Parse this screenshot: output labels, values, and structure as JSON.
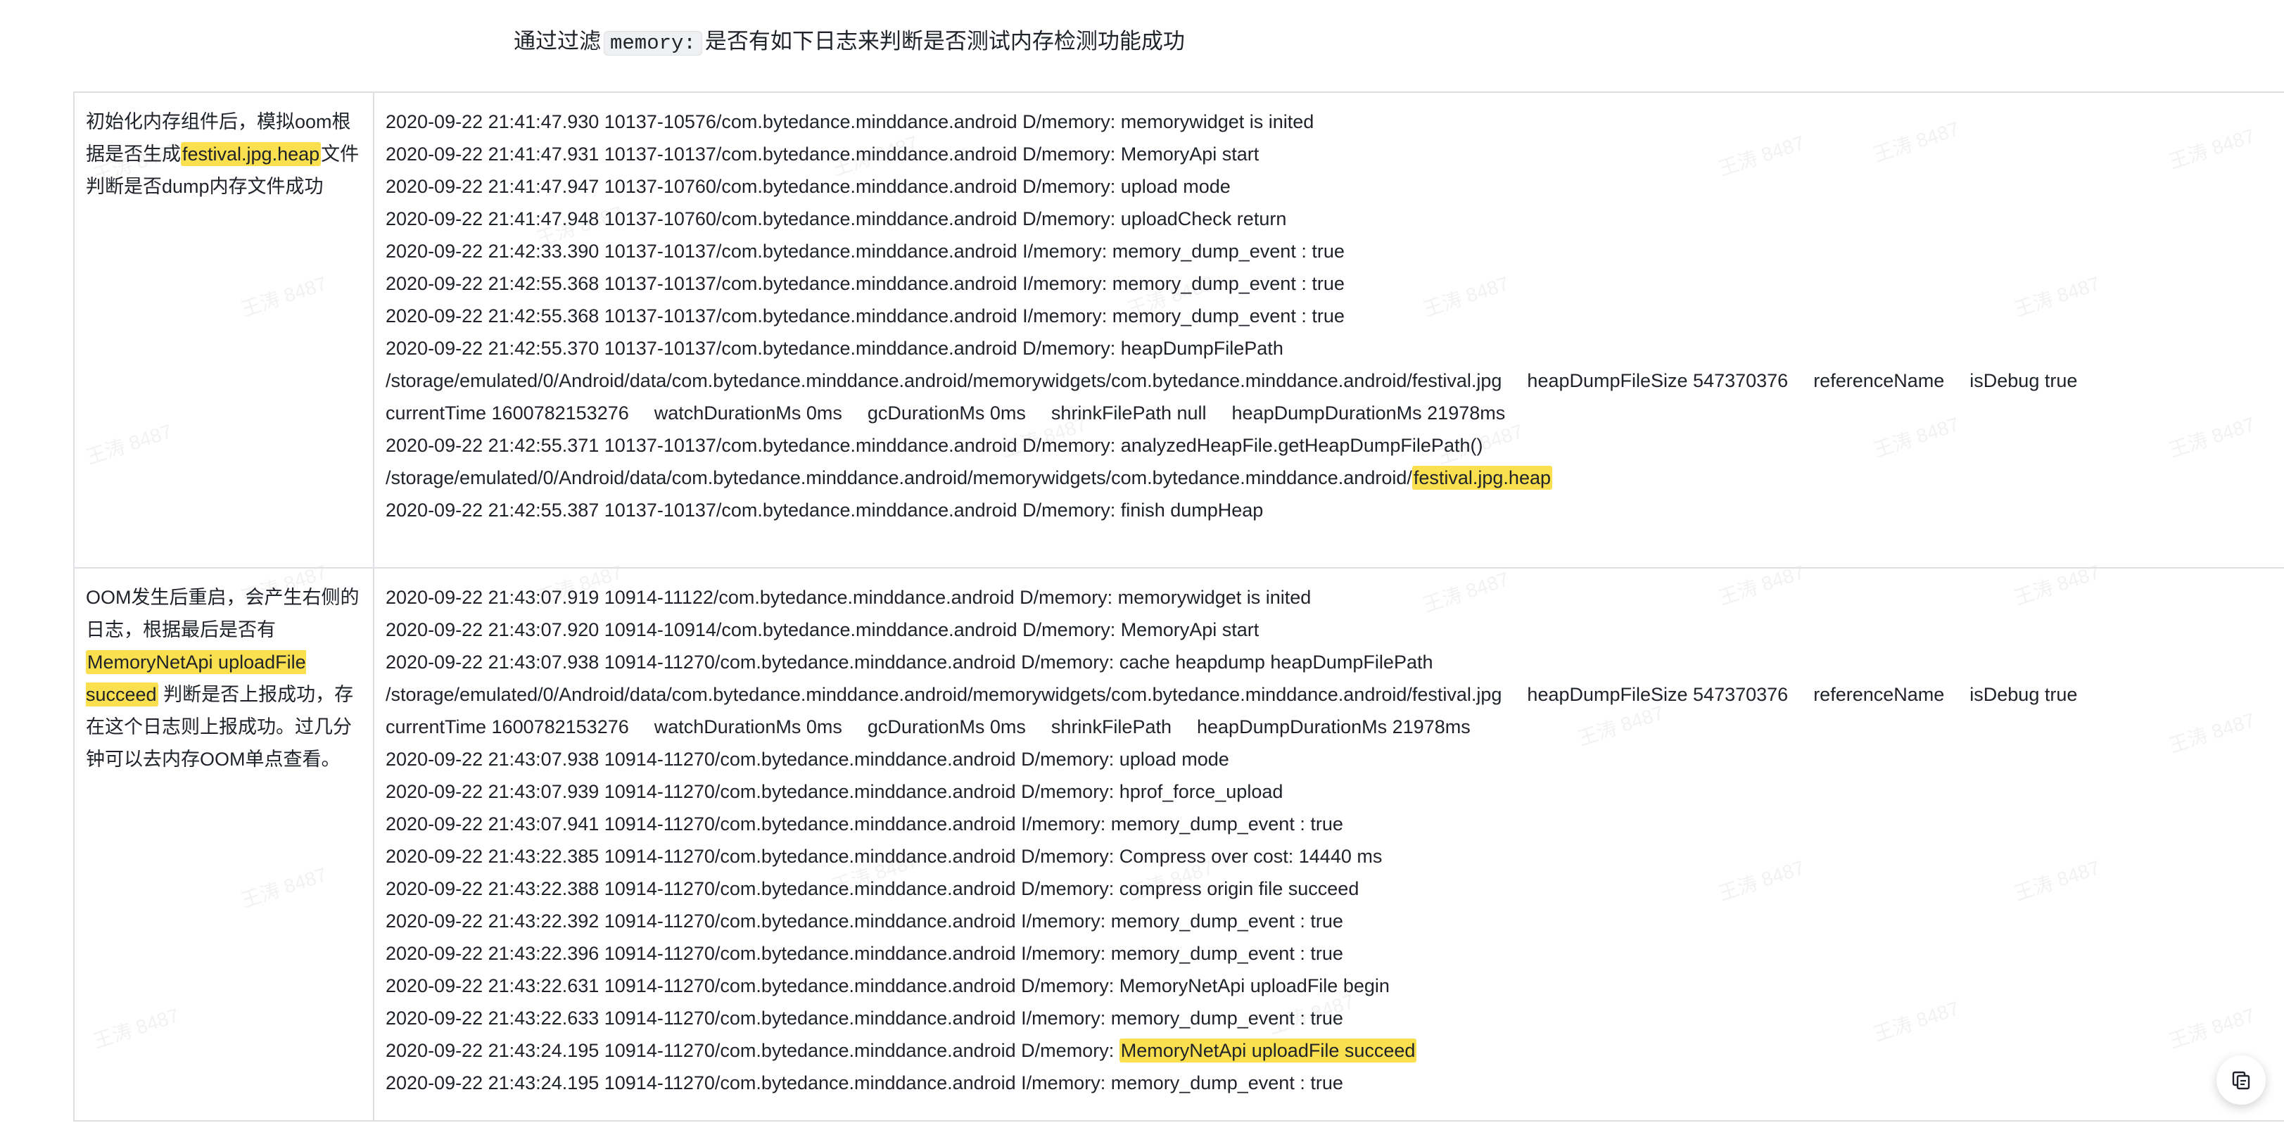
{
  "intro": {
    "prefix": "通过过滤",
    "code": "memory:",
    "suffix": "是否有如下日志来判断是否测试内存检测功能成功"
  },
  "watermark": "王涛 8487",
  "rows": [
    {
      "desc": {
        "part1": "初始化内存组件后，模拟oom根据是否生成",
        "highlight": "festival.jpg.heap",
        "part2": "文件判断是否dump内存文件成功"
      },
      "logs": [
        "2020-09-22 21:41:47.930 10137-10576/com.bytedance.minddance.android D/memory: memorywidget is inited",
        "2020-09-22 21:41:47.931 10137-10137/com.bytedance.minddance.android D/memory: MemoryApi start",
        "2020-09-22 21:41:47.947 10137-10760/com.bytedance.minddance.android D/memory: upload mode",
        "2020-09-22 21:41:47.948 10137-10760/com.bytedance.minddance.android D/memory: uploadCheck return",
        "2020-09-22 21:42:33.390 10137-10137/com.bytedance.minddance.android I/memory: memory_dump_event : true",
        "2020-09-22 21:42:55.368 10137-10137/com.bytedance.minddance.android I/memory: memory_dump_event : true",
        "2020-09-22 21:42:55.368 10137-10137/com.bytedance.minddance.android I/memory: memory_dump_event : true"
      ],
      "heap_dump": {
        "line1": "2020-09-22 21:42:55.370 10137-10137/com.bytedance.minddance.android D/memory:  heapDumpFilePath",
        "path": "/storage/emulated/0/Android/data/com.bytedance.minddance.android/memorywidgets/com.bytedance.minddance.android/festival.jpg",
        "size": "heapDumpFileSize 547370376",
        "ref": "referenceName",
        "debug": "isDebug true",
        "time": "currentTime 1600782153276",
        "watch": "watchDurationMs 0ms",
        "gc": "gcDurationMs 0ms",
        "shrink": "shrinkFilePath null",
        "duration": "heapDumpDurationMs 21978ms"
      },
      "analyzed": {
        "line1": "2020-09-22 21:42:55.371 10137-10137/com.bytedance.minddance.android D/memory: analyzedHeapFile.getHeapDumpFilePath()",
        "path_prefix": "/storage/emulated/0/Android/data/com.bytedance.minddance.android/memorywidgets/com.bytedance.minddance.android/",
        "path_highlight": "festival.jpg.heap"
      },
      "last": "2020-09-22 21:42:55.387 10137-10137/com.bytedance.minddance.android D/memory: finish dumpHeap"
    },
    {
      "desc": {
        "part1": "OOM发生后重启，会产生右侧的日志，根据最后是否有",
        "highlight": "MemoryNetApi uploadFile succeed",
        "part2": "判断是否上报成功，存在这个日志则上报成功。过几分钟可以去内存OOM单点查看。"
      },
      "logs_before": [
        "2020-09-22 21:43:07.919 10914-11122/com.bytedance.minddance.android D/memory: memorywidget is inited",
        "2020-09-22 21:43:07.920 10914-10914/com.bytedance.minddance.android D/memory: MemoryApi start"
      ],
      "heap_dump": {
        "line1": "2020-09-22 21:43:07.938 10914-11270/com.bytedance.minddance.android D/memory: cache heapdump  heapDumpFilePath",
        "path": "/storage/emulated/0/Android/data/com.bytedance.minddance.android/memorywidgets/com.bytedance.minddance.android/festival.jpg",
        "size": "heapDumpFileSize 547370376",
        "ref": "referenceName",
        "debug": "isDebug true",
        "time": "currentTime 1600782153276",
        "watch": "watchDurationMs 0ms",
        "gc": "gcDurationMs 0ms",
        "shrink": "shrinkFilePath",
        "duration": "heapDumpDurationMs 21978ms"
      },
      "logs_after": [
        "2020-09-22 21:43:07.938 10914-11270/com.bytedance.minddance.android D/memory: upload mode",
        "2020-09-22 21:43:07.939 10914-11270/com.bytedance.minddance.android D/memory: hprof_force_upload",
        "2020-09-22 21:43:07.941 10914-11270/com.bytedance.minddance.android I/memory: memory_dump_event : true",
        "2020-09-22 21:43:22.385 10914-11270/com.bytedance.minddance.android D/memory: Compress over cost:  14440 ms",
        "2020-09-22 21:43:22.388 10914-11270/com.bytedance.minddance.android D/memory: compress origin file succeed",
        "2020-09-22 21:43:22.392 10914-11270/com.bytedance.minddance.android I/memory: memory_dump_event : true",
        "2020-09-22 21:43:22.396 10914-11270/com.bytedance.minddance.android I/memory: memory_dump_event : true",
        "2020-09-22 21:43:22.631 10914-11270/com.bytedance.minddance.android D/memory: MemoryNetApi uploadFile begin",
        "2020-09-22 21:43:22.633 10914-11270/com.bytedance.minddance.android I/memory: memory_dump_event : true"
      ],
      "succeed": {
        "prefix": "2020-09-22 21:43:24.195 10914-11270/com.bytedance.minddance.android D/memory: ",
        "highlight": "MemoryNetApi uploadFile succeed"
      },
      "last": "2020-09-22 21:43:24.195 10914-11270/com.bytedance.minddance.android I/memory: memory_dump_event : true"
    }
  ],
  "float_button": {
    "icon": "copy-link-icon"
  }
}
